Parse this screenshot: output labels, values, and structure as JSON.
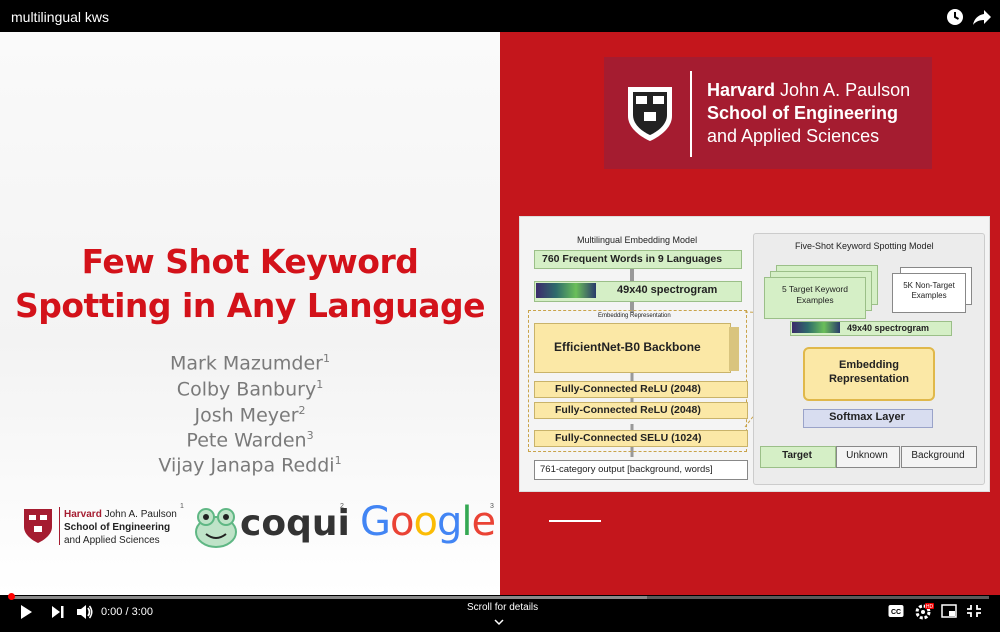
{
  "window": {
    "title": "multilingual kws"
  },
  "slide": {
    "title_line1": "Few Shot Keyword",
    "title_line2": "Spotting in Any Language",
    "authors": [
      {
        "name": "Mark Mazumder",
        "sup": "1"
      },
      {
        "name": "Colby Banbury",
        "sup": "1"
      },
      {
        "name": "Josh Meyer",
        "sup": "2"
      },
      {
        "name": "Pete Warden",
        "sup": "3"
      },
      {
        "name": "Vijay Janapa Reddi",
        "sup": "1"
      }
    ],
    "logos": {
      "harvard_line1_bold": "Harvard",
      "harvard_line1_rest": " John A. Paulson",
      "harvard_line2": "School of Engineering",
      "harvard_line3": "and Applied Sciences",
      "harvard_sup": "1",
      "coqui": "coqui",
      "coqui_sup": "2",
      "google": "Google",
      "google_sup": "3"
    },
    "harvard_banner": {
      "line1_bold": "Harvard",
      "line1_rest": " John A. Paulson",
      "line2": "School of Engineering",
      "line3": "and Applied Sciences"
    },
    "diagram": {
      "left_title": "Multilingual Embedding Model",
      "words_box": "760 Frequent Words in 9 Languages",
      "spectrogram_left": "49x40 spectrogram",
      "embedding_rep_label": "Embedding Representation",
      "backbone": "EfficientNet-B0 Backbone",
      "fc1": "Fully-Connected ReLU (2048)",
      "fc2": "Fully-Connected ReLU (2048)",
      "fc3": "Fully-Connected SELU (1024)",
      "output": "761-category output [background, words]",
      "right_title": "Five-Shot Keyword Spotting Model",
      "target_examples": "5 Target Keyword Examples",
      "nontarget_examples": "5K Non-Target Examples",
      "spectrogram_right": "49x40 spectrogram",
      "embedding_box": "Embedding Representation",
      "softmax": "Softmax Layer",
      "out_target": "Target",
      "out_unknown": "Unknown",
      "out_background": "Background"
    }
  },
  "player": {
    "time": "0:00 / 3:00",
    "scroll_hint": "Scroll for details",
    "progress_buffered_fraction": 0.65,
    "icons": [
      "play-icon",
      "next-icon",
      "volume-icon",
      "captions-icon",
      "settings-icon",
      "miniplayer-icon",
      "cast-icon",
      "fullscreen-exit-icon",
      "clock-icon",
      "share-icon"
    ]
  },
  "colors": {
    "accent_red": "#c4161c",
    "harvard_crimson": "#a51c30",
    "title_red": "#d3121a"
  }
}
